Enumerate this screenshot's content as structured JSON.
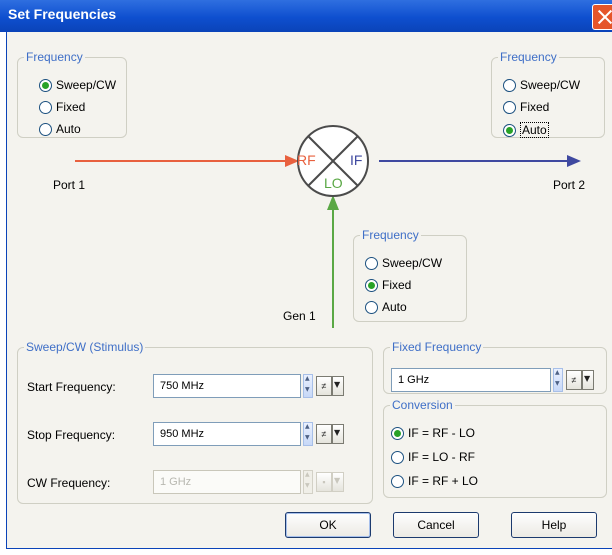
{
  "window": {
    "title": "Set Frequencies"
  },
  "rf_group": {
    "legend": "Frequency",
    "options": [
      "Sweep/CW",
      "Fixed",
      "Auto"
    ],
    "selected": "Sweep/CW"
  },
  "if_group": {
    "legend": "Frequency",
    "options": [
      "Sweep/CW",
      "Fixed",
      "Auto"
    ],
    "selected": "Auto"
  },
  "lo_group": {
    "legend": "Frequency",
    "options": [
      "Sweep/CW",
      "Fixed",
      "Auto"
    ],
    "selected": "Fixed"
  },
  "diagram": {
    "rf": "RF",
    "if": "IF",
    "lo": "LO",
    "port1": "Port 1",
    "port2": "Port 2",
    "gen1": "Gen 1",
    "colors": {
      "rf": "#e8603e",
      "if": "#3f49a0",
      "lo": "#5aa845"
    }
  },
  "sweep": {
    "legend": "Sweep/CW (Stimulus)",
    "start_label": "Start Frequency:",
    "start_value": "750 MHz",
    "stop_label": "Stop Frequency:",
    "stop_value": "950 MHz",
    "cw_label": "CW Frequency:",
    "cw_value": "1 GHz"
  },
  "fixed": {
    "legend": "Fixed Frequency",
    "value": "1 GHz"
  },
  "conversion": {
    "legend": "Conversion",
    "options": [
      "IF = RF - LO",
      "IF = LO - RF",
      "IF = RF + LO"
    ],
    "selected": "IF = RF - LO"
  },
  "buttons": {
    "ok": "OK",
    "cancel": "Cancel",
    "help": "Help"
  },
  "step_symbol": "≠"
}
